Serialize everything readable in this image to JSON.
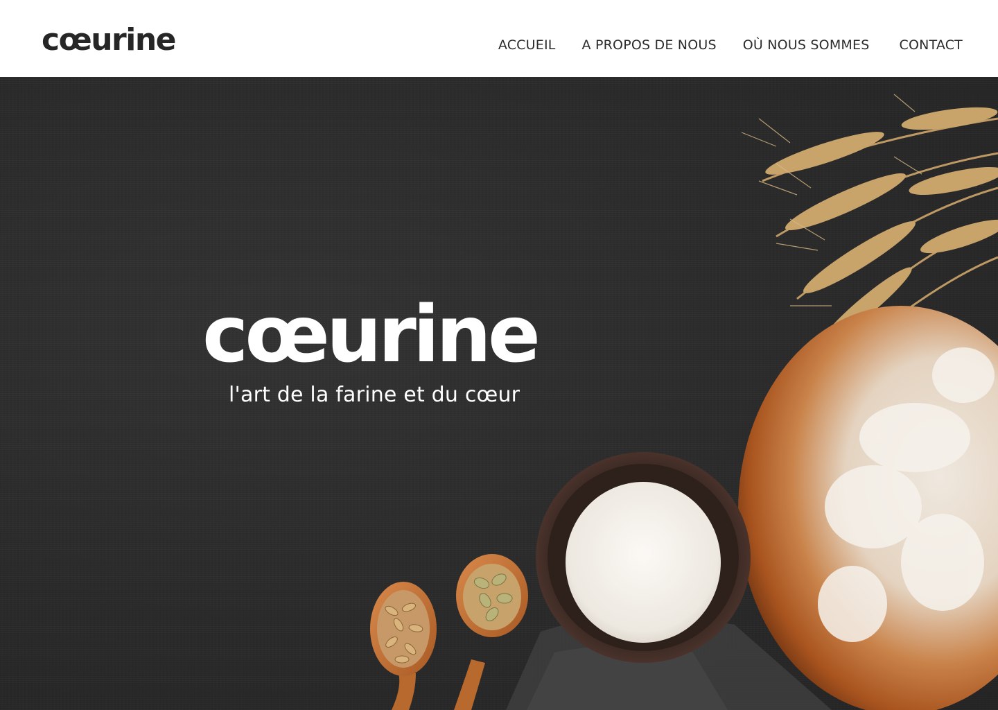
{
  "header": {
    "brand": "cœurine",
    "nav": [
      {
        "label": "ACCUEIL"
      },
      {
        "label": "A PROPOS DE NOUS"
      },
      {
        "label": "OÙ NOUS SOMMES"
      },
      {
        "label": "CONTACT"
      }
    ]
  },
  "hero": {
    "title": "cœurine",
    "tagline": "l'art de la farine et du cœur",
    "background_color": "#2a2a2a"
  },
  "colors": {
    "header_bg": "#ffffff",
    "text_dark": "#262626",
    "hero_text": "#ffffff",
    "bread_crust": "#b8642a",
    "flour": "#f4f1ec",
    "wood_spoon": "#c9772f",
    "wheat": "#c9a46a"
  }
}
